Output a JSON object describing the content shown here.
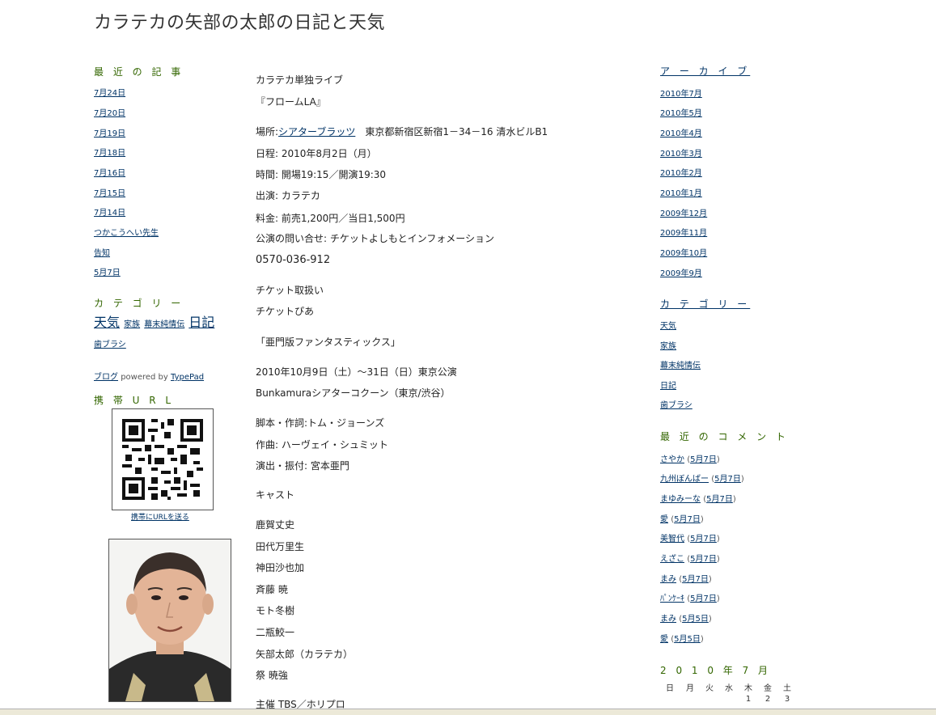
{
  "site": {
    "title": "カラテカの矢部の太郎の日記と天気"
  },
  "left": {
    "recent_posts_heading": "最 近 の 記 事",
    "recent_posts": [
      "7月24日",
      "7月20日",
      "7月19日",
      "7月18日",
      "7月16日",
      "7月15日",
      "7月14日",
      "つかこうへい先生",
      "告知",
      "5月7日"
    ],
    "category_heading": "カ テ ゴ リ ー",
    "category_cloud": [
      {
        "label": "天気",
        "size": "big"
      },
      {
        "label": "家族",
        "size": "small"
      },
      {
        "label": "幕末純情伝",
        "size": "small"
      },
      {
        "label": "日記",
        "size": "big"
      },
      {
        "label": "歯ブラシ",
        "size": "small"
      }
    ],
    "powered": {
      "blog": "ブログ",
      "text": "powered by",
      "typepad": "TypePad"
    },
    "mobile_heading": "携 帯 U R L",
    "send_mobile": "携帯にURLを送る"
  },
  "main": {
    "lines": [
      {
        "text": "カラテカ単独ライブ"
      },
      {
        "text": "『フロームLA』"
      },
      {
        "label": "場所:",
        "link": "シアターブラッツ",
        "text": "　東京都新宿区新宿1－34－16 清水ビルB1"
      },
      {
        "text": "日程: 2010年8月2日（月）"
      },
      {
        "text": "時間: 開場19:15／開演19:30"
      },
      {
        "text": "出演: カラテカ"
      },
      {
        "text": "料金: 前売1,200円／当日1,500円"
      },
      {
        "text": "公演の問い合せ: チケットよしもとインフォメーション"
      },
      {
        "text": "0570-036-912"
      },
      {
        "text": "チケット取扱い"
      },
      {
        "text": "チケットぴあ"
      },
      {
        "text": "「亜門版ファンタスティックス」"
      },
      {
        "text": "2010年10月9日（土）～31日（日）東京公演"
      },
      {
        "text": "Bunkamuraシアターコクーン（東京/渋谷）"
      },
      {
        "text": "脚本・作詞:トム・ジョーンズ"
      },
      {
        "text": "作曲: ハーヴェイ・シュミット"
      },
      {
        "text": "演出・振付: 宮本亜門"
      },
      {
        "text": "キャスト"
      },
      {
        "text": "鹿賀丈史"
      },
      {
        "text": "田代万里生"
      },
      {
        "text": "神田沙也加"
      },
      {
        "text": "斉藤 暁"
      },
      {
        "text": "モト冬樹"
      },
      {
        "text": "二瓶鮫一"
      },
      {
        "text": "矢部太郎（カラテカ）"
      },
      {
        "text": "祭 暁強"
      },
      {
        "text": "主催 TBS／ホリプロ"
      }
    ]
  },
  "right": {
    "archive_heading": "ア ー カ イ ブ",
    "archives": [
      "2010年7月",
      "2010年5月",
      "2010年4月",
      "2010年3月",
      "2010年2月",
      "2010年1月",
      "2009年12月",
      "2009年11月",
      "2009年10月",
      "2009年9月"
    ],
    "category_heading": "カ テ ゴ リ ー",
    "categories": [
      "天気",
      "家族",
      "幕末純情伝",
      "日記",
      "歯ブラシ"
    ],
    "comments_heading": "最 近 の コ メ ン ト",
    "comments": [
      {
        "name": "さやか",
        "post": "5月7日"
      },
      {
        "name": "九州ぼんばー",
        "post": "5月7日"
      },
      {
        "name": "まゆみーな",
        "post": "5月7日"
      },
      {
        "name": "愛",
        "post": "5月7日"
      },
      {
        "name": "美智代",
        "post": "5月7日"
      },
      {
        "name": "えざこ",
        "post": "5月7日"
      },
      {
        "name": "まみ",
        "post": "5月7日"
      },
      {
        "name": "ﾊﾟﾝｹｰｷ",
        "post": "5月7日"
      },
      {
        "name": "まみ",
        "post": "5月5日"
      },
      {
        "name": "愛",
        "post": "5月5日"
      }
    ],
    "calendar": {
      "heading": "2 0 1 0 年 7 月",
      "weekdays": [
        "日",
        "月",
        "火",
        "水",
        "木",
        "金",
        "土"
      ],
      "first_row": [
        "",
        "",
        "",
        "",
        "1",
        "2",
        "3"
      ]
    }
  }
}
